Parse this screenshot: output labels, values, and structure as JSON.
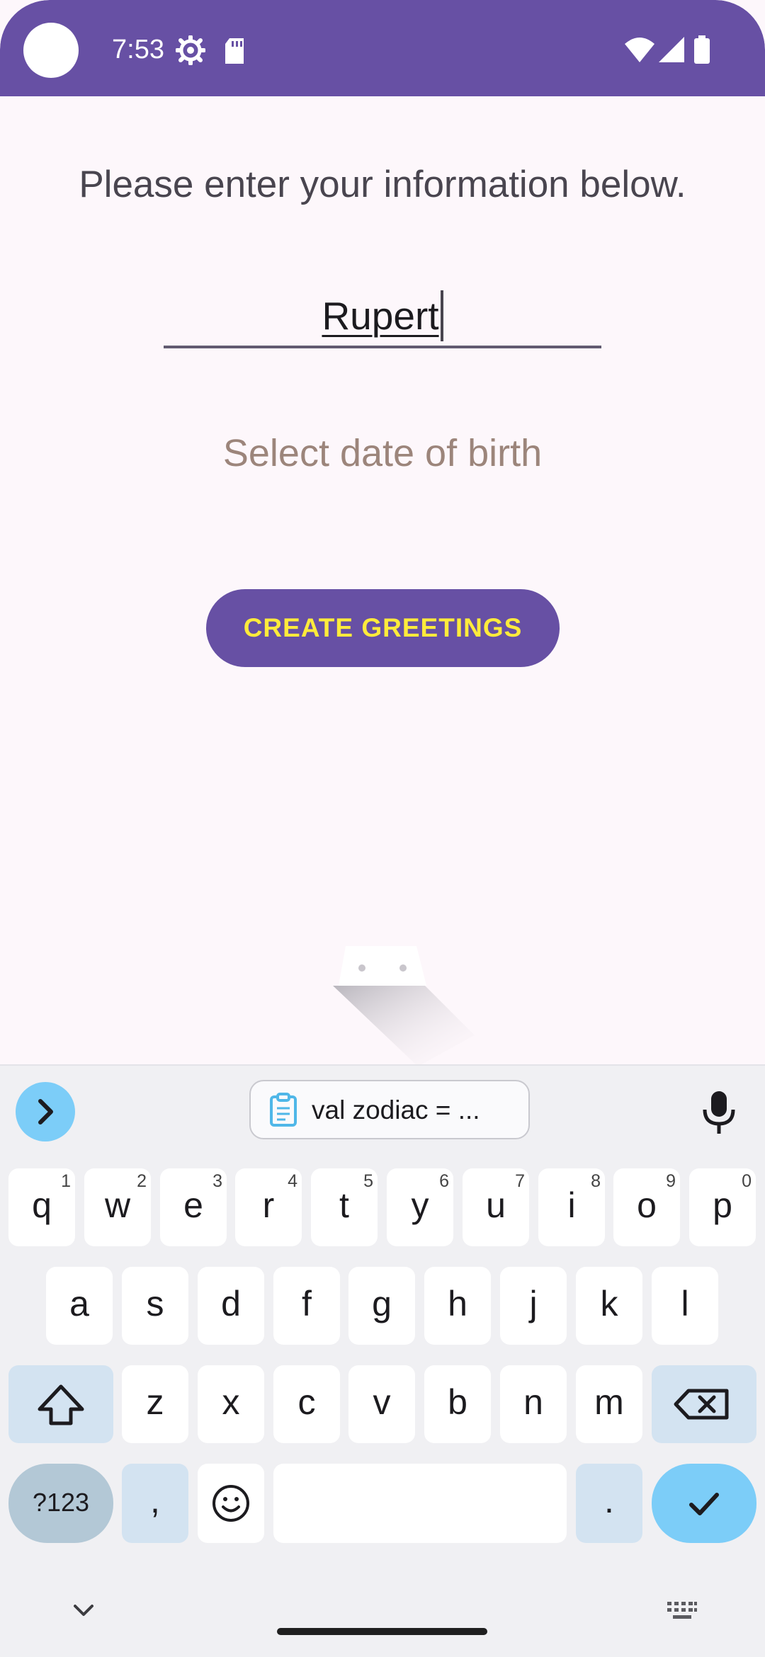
{
  "status_bar": {
    "time": "7:53"
  },
  "app": {
    "prompt": "Please enter your information below.",
    "name_value": "Rupert",
    "dob_label": "Select date of birth",
    "create_button_label": "CREATE GREETINGS"
  },
  "keyboard": {
    "clipboard_text": "val zodiac = ...",
    "row1": [
      {
        "label": "q",
        "hint": "1"
      },
      {
        "label": "w",
        "hint": "2"
      },
      {
        "label": "e",
        "hint": "3"
      },
      {
        "label": "r",
        "hint": "4"
      },
      {
        "label": "t",
        "hint": "5"
      },
      {
        "label": "y",
        "hint": "6"
      },
      {
        "label": "u",
        "hint": "7"
      },
      {
        "label": "i",
        "hint": "8"
      },
      {
        "label": "o",
        "hint": "9"
      },
      {
        "label": "p",
        "hint": "0"
      }
    ],
    "row2": [
      "a",
      "s",
      "d",
      "f",
      "g",
      "h",
      "j",
      "k",
      "l"
    ],
    "row3": [
      "z",
      "x",
      "c",
      "v",
      "b",
      "n",
      "m"
    ],
    "symbols_label": "?123",
    "comma_label": ",",
    "period_label": "."
  }
}
